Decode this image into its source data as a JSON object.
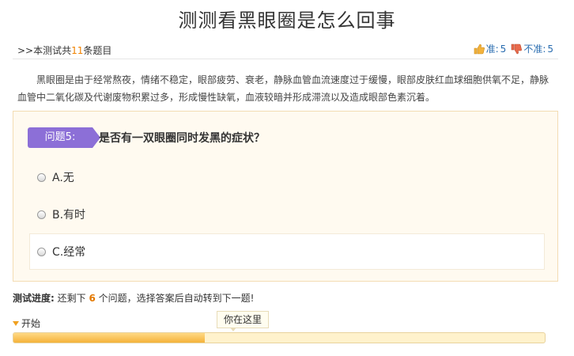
{
  "page": {
    "title": "测测看黑眼圈是怎么回事"
  },
  "meta": {
    "prefix": ">>本测试共",
    "count": "11",
    "suffix": "条题目",
    "accurate_label": "准:",
    "accurate_value": "5",
    "inaccurate_label": "不准:",
    "inaccurate_value": "5"
  },
  "intro": "黑眼圈是由于经常熬夜，情绪不稳定，眼部疲劳、衰老，静脉血管血流速度过于缓慢，眼部皮肤红血球细胞供氧不足，静脉血管中二氧化碳及代谢废物积累过多，形成慢性缺氧，血液较暗并形成滞流以及造成眼部色素沉着。",
  "question": {
    "badge": "问题5:",
    "text": "是否有一双眼圈同时发黑的症状？",
    "options": [
      {
        "label": "A.无"
      },
      {
        "label": "B.有时"
      },
      {
        "label": "C.经常"
      }
    ]
  },
  "progress": {
    "label": "测试进度:",
    "pre": "还剩下",
    "remaining": "6",
    "post": "个问题，选择答案后自动转到下一题!",
    "start": "开始",
    "marker": "你在这里",
    "fraction": 0.36
  },
  "colors": {
    "badge": "#8c6fd7",
    "accent": "#f08200",
    "bar": "#f5b23a"
  }
}
